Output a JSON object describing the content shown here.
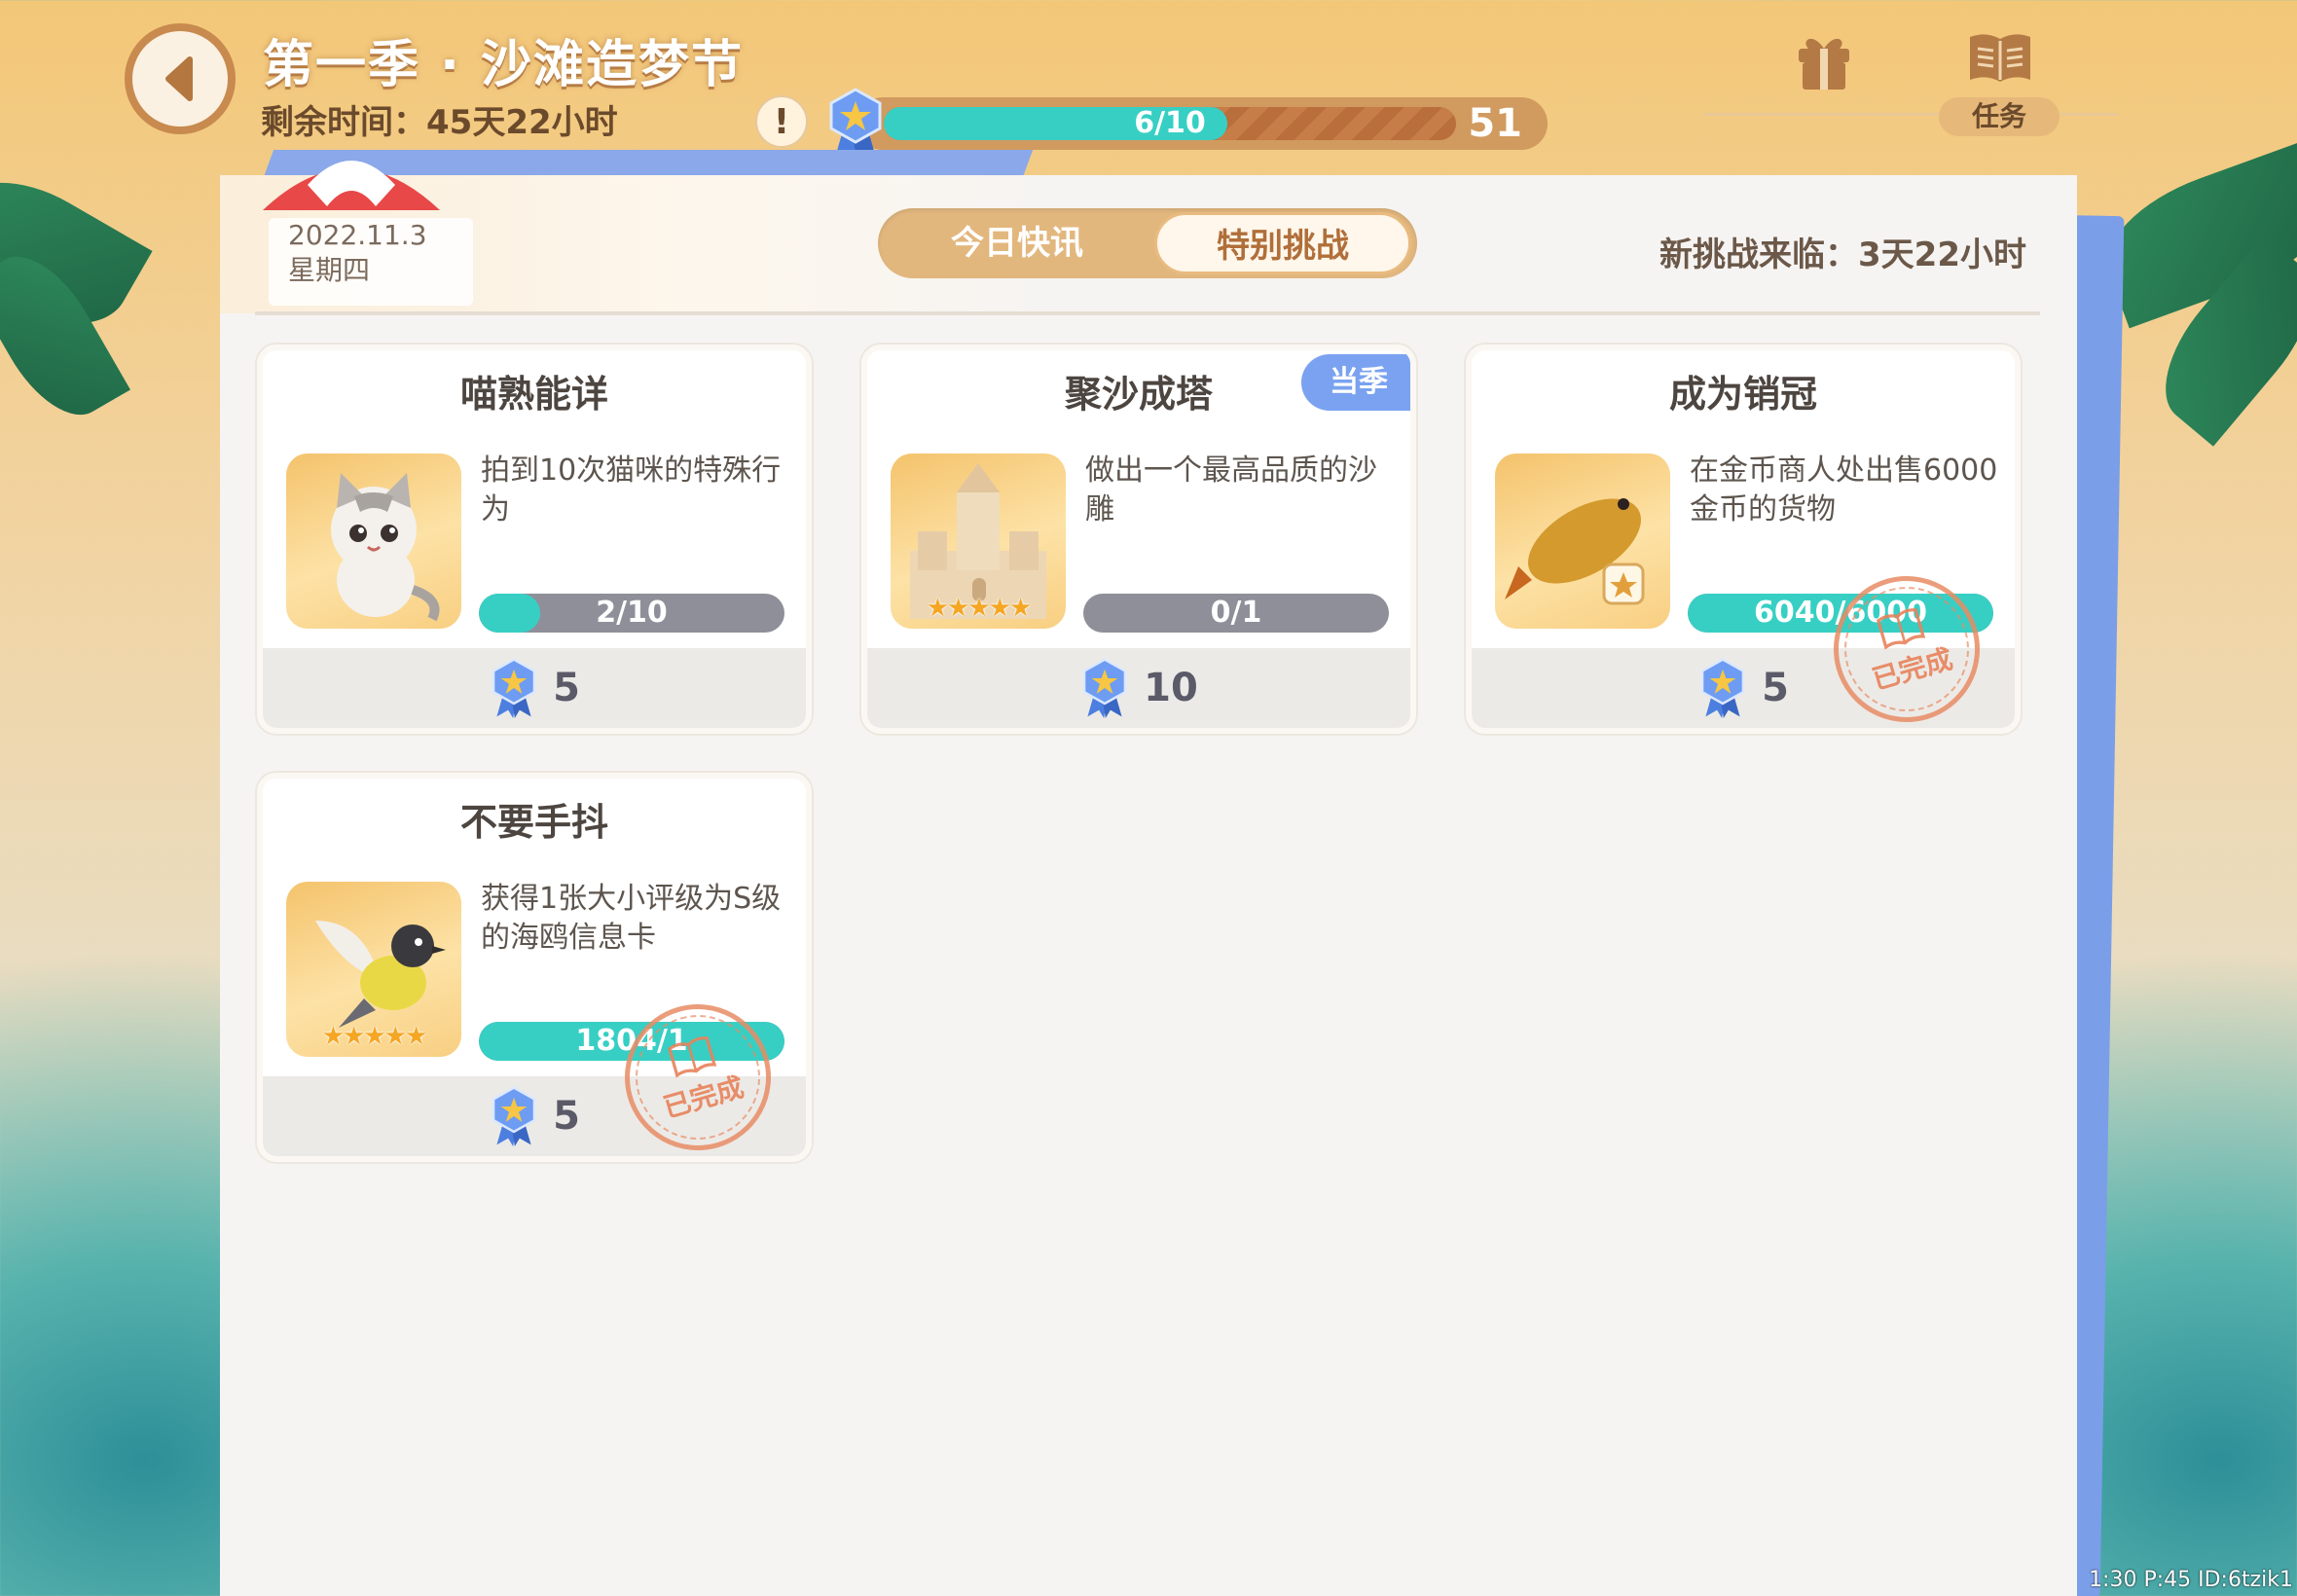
{
  "header": {
    "season_title": "第一季 · 沙滩造梦节",
    "remaining": "剩余时间：45天22小时",
    "alert_symbol": "!",
    "progress": {
      "text": "6/10",
      "fraction": 0.6,
      "level": "51"
    },
    "task_label": "任务"
  },
  "panel": {
    "date": "2022.11.3",
    "weekday": "星期四",
    "tabs": [
      {
        "label": "今日快讯",
        "active": false
      },
      {
        "label": "特别挑战",
        "active": true
      }
    ],
    "new_challenge": "新挑战来临：3天22小时"
  },
  "cards": [
    {
      "title": "喵熟能详",
      "desc": "拍到10次猫咪的特殊行为",
      "progress_text": "2/10",
      "progress": 0.2,
      "reward": "5",
      "image": "cat",
      "completed": false
    },
    {
      "title": "聚沙成塔",
      "desc": "做出一个最高品质的沙雕",
      "progress_text": "0/1",
      "progress": 0.0,
      "reward": "10",
      "image": "sandcastle",
      "badge": "当季",
      "completed": false
    },
    {
      "title": "成为销冠",
      "desc": "在金币商人处出售6000金币的货物",
      "progress_text": "6040/6000",
      "progress": 1.0,
      "reward": "5",
      "image": "fish",
      "completed": true
    },
    {
      "title": "不要手抖",
      "desc": "获得1张大小评级为S级的海鸥信息卡",
      "progress_text": "1804/1",
      "progress": 1.0,
      "reward": "5",
      "image": "seagull",
      "completed": true
    }
  ],
  "stamp_text": "已完成",
  "stars": "★★★★★",
  "debug": "1:30  P:45  ID:6tzik1",
  "colors": {
    "teal": "#37cfc4",
    "accent": "#e2b77e",
    "badge_blue": "#7aa2f0"
  }
}
